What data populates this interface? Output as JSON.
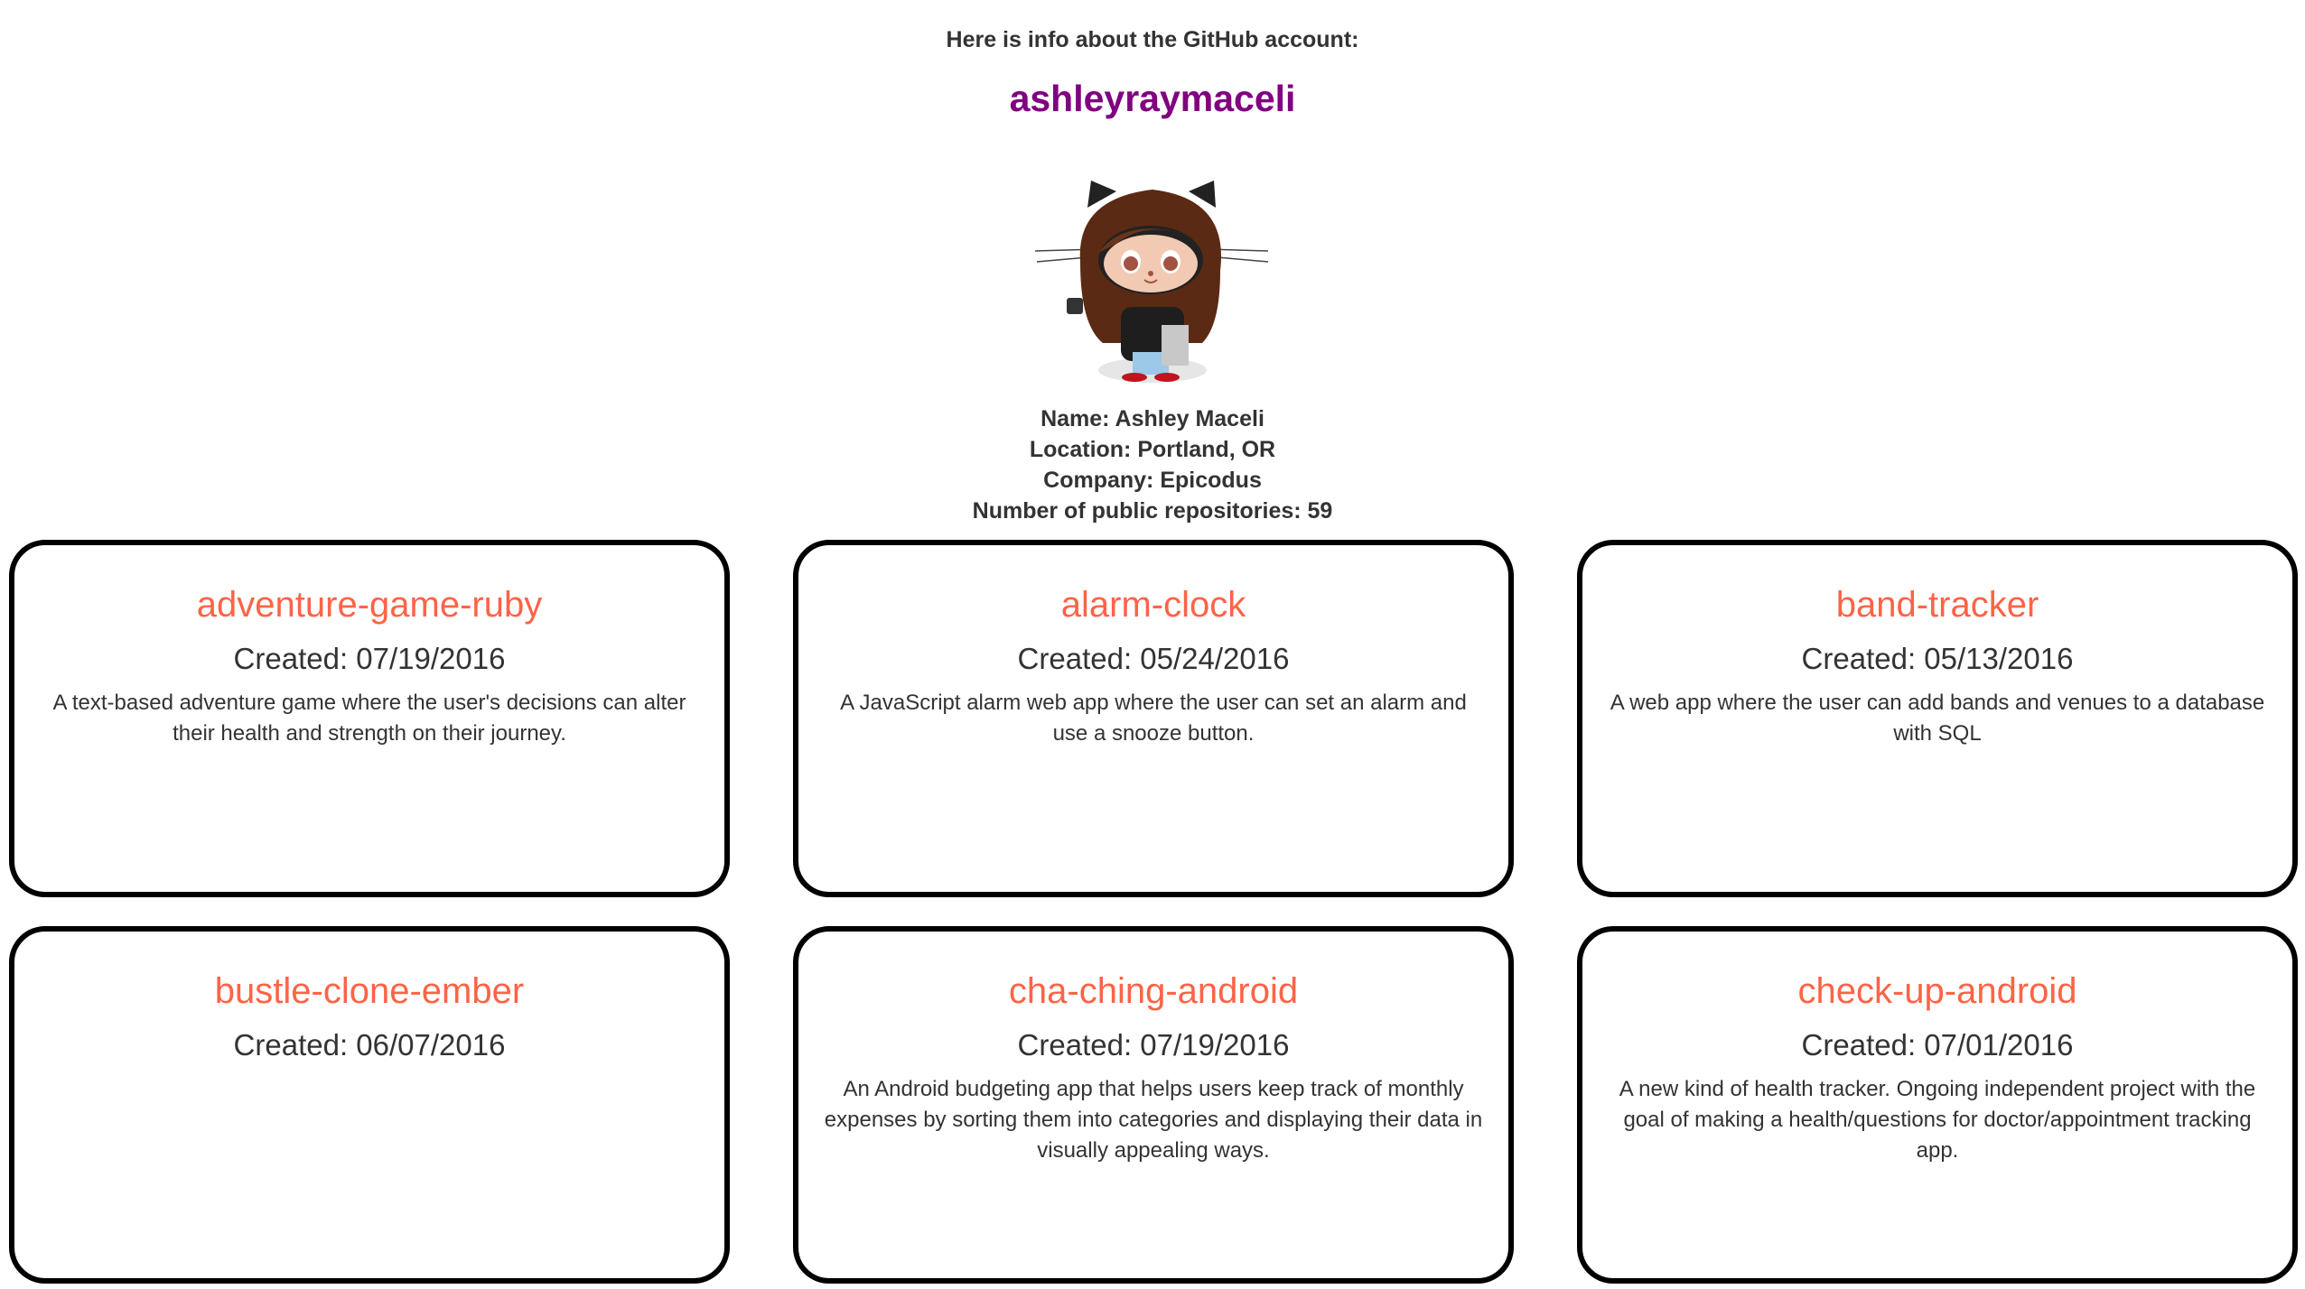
{
  "header": {
    "intro": "Here is info about the GitHub account:",
    "username": "ashleyraymaceli"
  },
  "avatar": {
    "icon": "octocat-avatar"
  },
  "info": {
    "name": "Name: Ashley Maceli",
    "location": "Location: Portland, OR",
    "company": "Company: Epicodus",
    "repos": "Number of public repositories: 59"
  },
  "colors": {
    "username": "#800080",
    "repo_title": "#ff6347",
    "text": "#333333",
    "card_border": "#000000"
  },
  "repos": [
    {
      "name": "adventure-game-ruby",
      "created": "Created: 07/19/2016",
      "description": "A text-based adventure game where the user's decisions can alter their health and strength on their journey."
    },
    {
      "name": "alarm-clock",
      "created": "Created: 05/24/2016",
      "description": "A JavaScript alarm web app where the user can set an alarm and use a snooze button."
    },
    {
      "name": "band-tracker",
      "created": "Created: 05/13/2016",
      "description": "A web app where the user can add bands and venues to a database with SQL"
    },
    {
      "name": "bustle-clone-ember",
      "created": "Created: 06/07/2016",
      "description": ""
    },
    {
      "name": "cha-ching-android",
      "created": "Created: 07/19/2016",
      "description": "An Android budgeting app that helps users keep track of monthly expenses by sorting them into categories and displaying their data in visually appealing ways."
    },
    {
      "name": "check-up-android",
      "created": "Created: 07/01/2016",
      "description": "A new kind of health tracker. Ongoing independent project with the goal of making a health/questions for doctor/appointment tracking app."
    }
  ]
}
